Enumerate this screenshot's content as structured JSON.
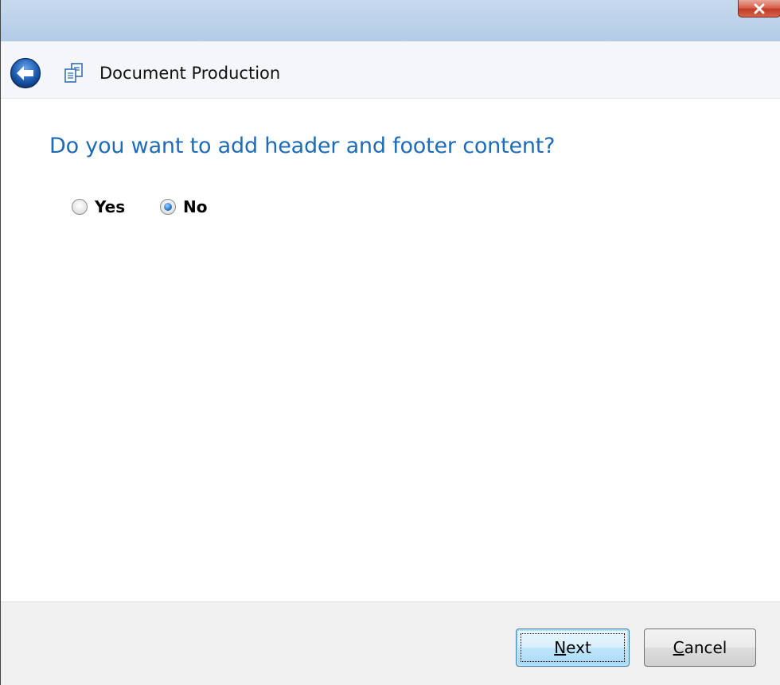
{
  "window": {
    "title": "Document Production",
    "close_glyph": "✕"
  },
  "nav": {
    "back_icon": "back-arrow-icon",
    "doc_icon": "document-production-icon",
    "title": "Document Production"
  },
  "content": {
    "question": "Do you want to add header and footer content?",
    "options": [
      {
        "label": "Yes",
        "selected": false
      },
      {
        "label": "No",
        "selected": true
      }
    ]
  },
  "footer": {
    "next_access_key": "N",
    "next_rest": "ext",
    "cancel_access_key": "C",
    "cancel_rest": "ancel"
  },
  "colors": {
    "question_text": "#1e6bb8",
    "close_button": "#c33b24"
  }
}
